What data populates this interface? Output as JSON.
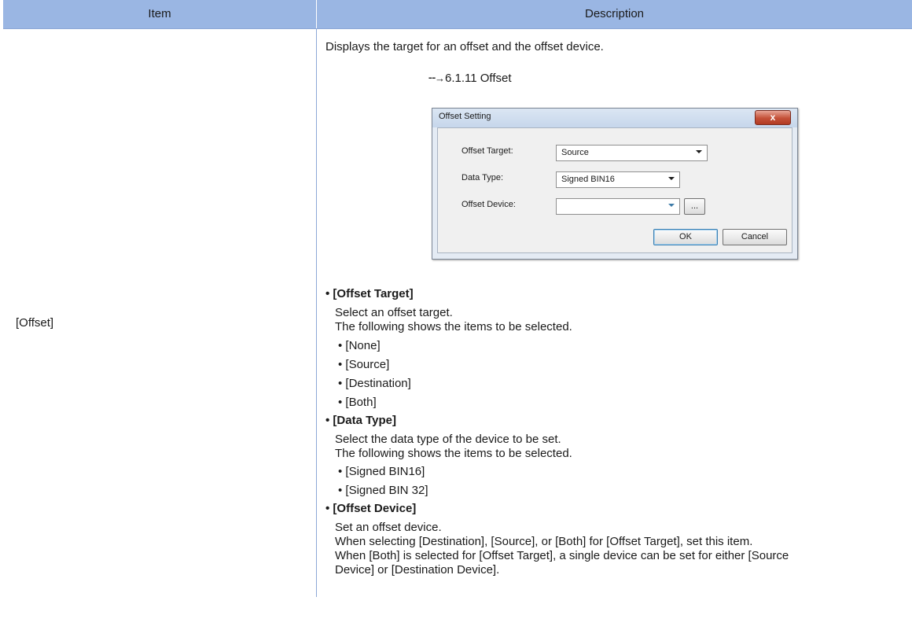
{
  "table": {
    "header_item": "Item",
    "header_description": "Description"
  },
  "row": {
    "item": "[Offset]",
    "intro": "Displays the target for an offset and the offset device.",
    "ref_arrow": "→",
    "ref_text": "6.1.11 Offset"
  },
  "dialog": {
    "title": "Offset Setting",
    "close_label": "x",
    "offset_target_label": "Offset Target:",
    "offset_target_value": "Source",
    "data_type_label": "Data Type:",
    "data_type_value": "Signed BIN16",
    "offset_device_label": "Offset Device:",
    "offset_device_value": "",
    "browse_label": "...",
    "ok_label": "OK",
    "cancel_label": "Cancel"
  },
  "sections": {
    "offset_target": {
      "heading": "• [Offset Target]",
      "line1": "Select an offset target.",
      "line2": "The following shows the items to be selected.",
      "items": [
        "• [None]",
        "• [Source]",
        "• [Destination]",
        "• [Both]"
      ]
    },
    "data_type": {
      "heading": "• [Data Type]",
      "line1": "Select the data type of the device to be set.",
      "line2": "The following shows the items to be selected.",
      "items": [
        "• [Signed BIN16]",
        "• [Signed BIN 32]"
      ]
    },
    "offset_device": {
      "heading": "• [Offset Device]",
      "line1": "Set an offset device.",
      "line2": "When selecting [Destination], [Source], or [Both] for [Offset Target], set this item.",
      "line3": "When [Both] is selected for [Offset Target], a single device can be set for either [Source",
      "line4": "Device] or [Destination Device]."
    }
  }
}
